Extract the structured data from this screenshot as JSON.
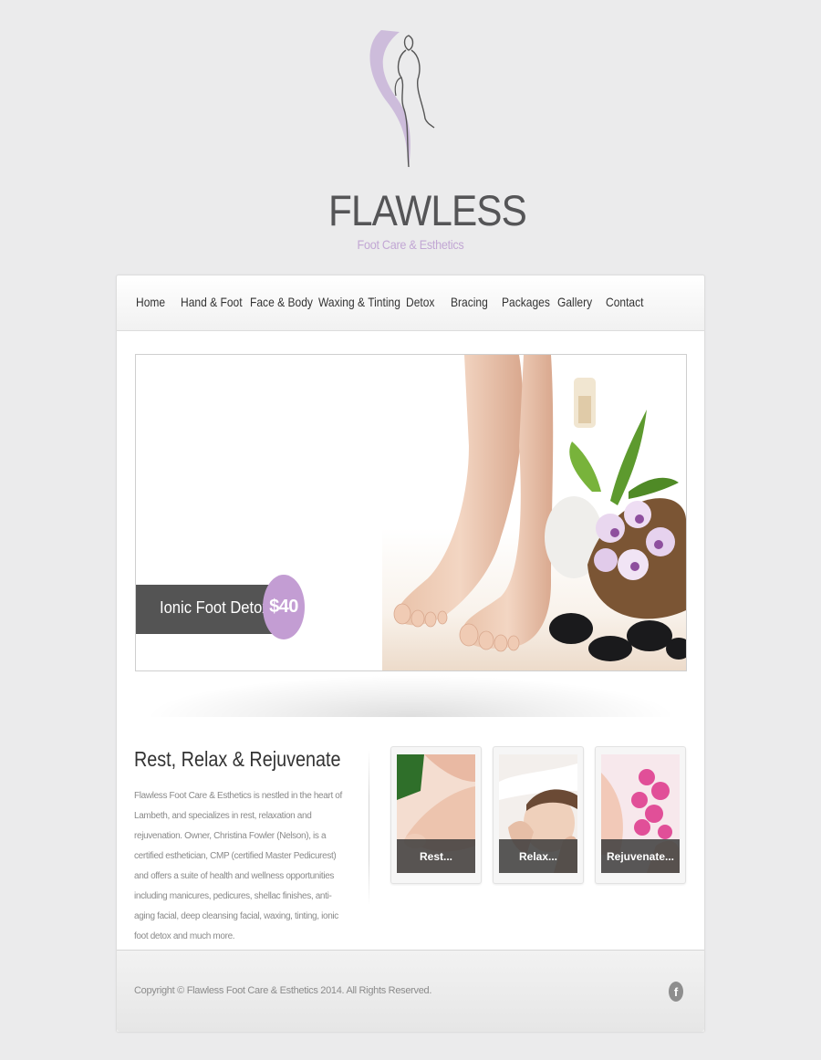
{
  "brand": {
    "name": "FLAWLESS",
    "tagline": "Foot Care & Esthetics"
  },
  "nav": {
    "items": [
      {
        "label": "Home"
      },
      {
        "label": "Hand & Foot"
      },
      {
        "label": "Face & Body"
      },
      {
        "label": "Waxing & Tinting"
      },
      {
        "label": "Detox"
      },
      {
        "label": "Bracing"
      },
      {
        "label": "Packages"
      },
      {
        "label": "Gallery"
      },
      {
        "label": "Contact"
      }
    ]
  },
  "hero": {
    "caption": "Ionic Foot Detox",
    "price": "$40"
  },
  "intro": {
    "title": "Rest, Relax & Rejuvenate",
    "body": "Flawless Foot Care & Esthetics is nestled in the heart of Lambeth, and specializes in rest, relaxation and rejuvenation. Owner, Christina Fowler (Nelson), is a certified esthetician, CMP (certified Master Pedicurest) and offers a suite of health and wellness opportunities including manicures, pedicures, shellac finishes, anti-aging facial, deep cleansing facial, waxing, tinting, ionic foot detox and much more."
  },
  "thumbnails": [
    {
      "label": "Rest..."
    },
    {
      "label": "Relax..."
    },
    {
      "label": "Rejuvenate..."
    }
  ],
  "footer": {
    "copyright": "Copyright © Flawless Foot Care & Esthetics 2014. All Rights Reserved.",
    "social_icon": "facebook-icon",
    "social_glyph": "f"
  },
  "colors": {
    "page_bg": "#ebebec",
    "accent": "#c39dd3",
    "caption_bg": "#545454"
  }
}
